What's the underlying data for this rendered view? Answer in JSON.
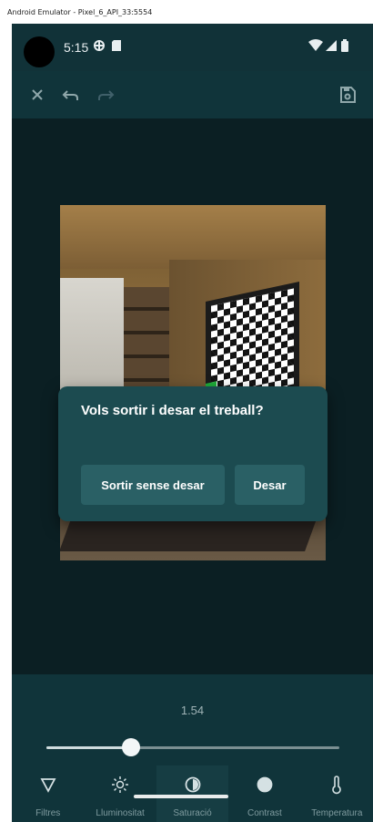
{
  "window": {
    "title": "Android Emulator - Pixel_6_API_33:5554"
  },
  "status_bar": {
    "time": "5:15"
  },
  "toolbar": {
    "close_icon": "close-icon",
    "undo_icon": "undo-icon",
    "redo_icon": "redo-icon",
    "save_icon": "save-icon"
  },
  "dialog": {
    "title": "Vols sortir i desar el treball?",
    "exit_button": "Sortir sense desar",
    "save_button": "Desar"
  },
  "adjustment": {
    "value_label": "1.54",
    "slider_fraction": 0.29
  },
  "tools": [
    {
      "label": "Filtres",
      "icon": "filter-icon",
      "active": false
    },
    {
      "label": "Lluminositat",
      "icon": "brightness-icon",
      "active": false
    },
    {
      "label": "Saturació",
      "icon": "saturation-icon",
      "active": true
    },
    {
      "label": "Contrast",
      "icon": "contrast-icon",
      "active": false
    },
    {
      "label": "Temperatura",
      "icon": "thermometer-icon",
      "active": false
    }
  ],
  "colors": {
    "background": "#0e2226",
    "panel": "#10343a",
    "dialog": "#1c4b50",
    "dialog_button": "#2a6065"
  }
}
